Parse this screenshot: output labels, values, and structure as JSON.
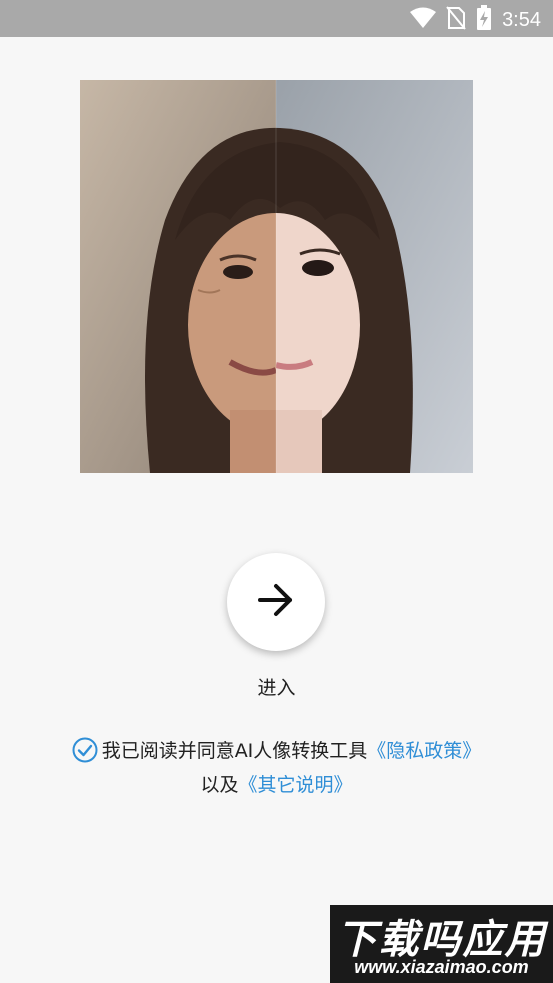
{
  "status_bar": {
    "time": "3:54",
    "icons": [
      "wifi-icon",
      "no-sim-icon",
      "battery-charging-icon"
    ]
  },
  "hero": {
    "image_description_icon": "face-comparison-image"
  },
  "enter": {
    "icon": "arrow-right-icon",
    "label": "进入"
  },
  "agreement": {
    "checked": true,
    "text": "我已阅读并同意AI人像转换工具",
    "privacy_link": "《隐私政策》",
    "connector": "以及",
    "other_link": "《其它说明》"
  },
  "watermark": {
    "title": "下载吗应用",
    "url": "www.xiazaimao.com"
  },
  "colors": {
    "status_bar": "#a9a9a9",
    "background": "#f7f7f7",
    "link": "#2f8ed6"
  }
}
